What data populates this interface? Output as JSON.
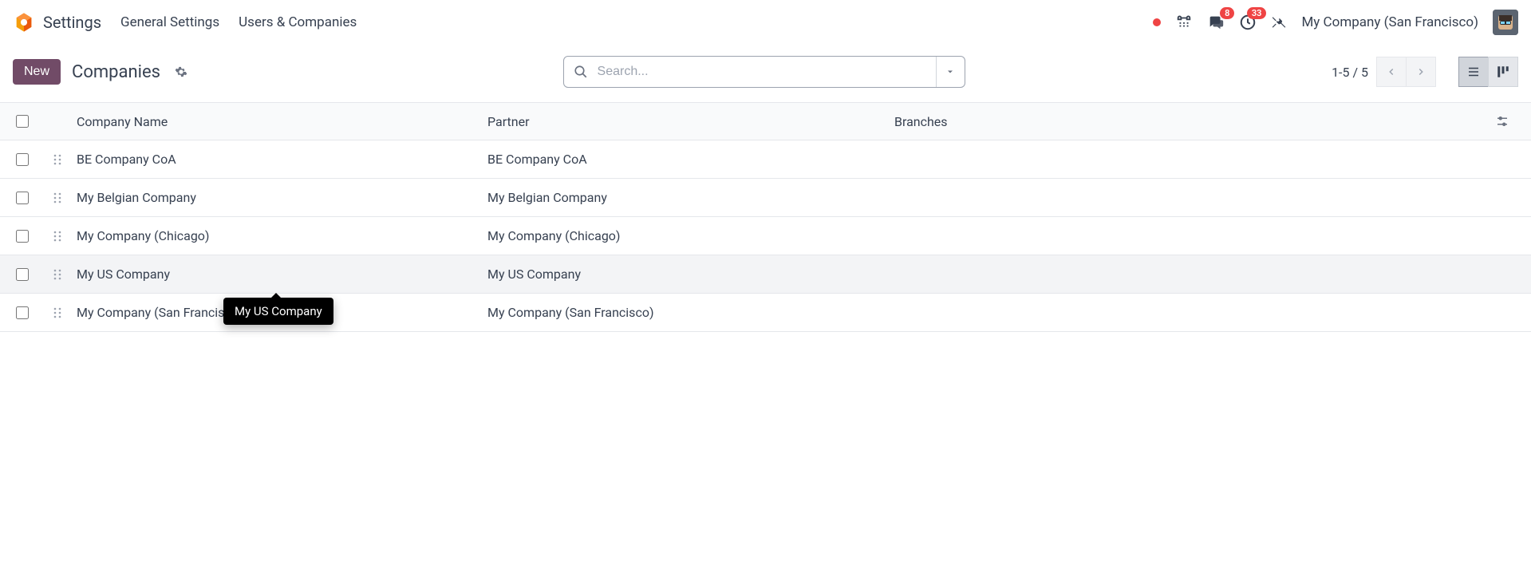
{
  "app": {
    "title": "Settings"
  },
  "nav": {
    "general": "General Settings",
    "users": "Users & Companies"
  },
  "topright": {
    "messages_badge": "8",
    "activities_badge": "33",
    "company": "My Company (San Francisco)"
  },
  "controls": {
    "new_label": "New",
    "breadcrumb": "Companies",
    "search_placeholder": "Search...",
    "pager": "1-5 / 5"
  },
  "table": {
    "headers": {
      "name": "Company Name",
      "partner": "Partner",
      "branches": "Branches"
    },
    "rows": [
      {
        "name": "BE Company CoA",
        "partner": "BE Company CoA",
        "branches": ""
      },
      {
        "name": "My Belgian Company",
        "partner": "My Belgian Company",
        "branches": ""
      },
      {
        "name": "My Company (Chicago)",
        "partner": "My Company (Chicago)",
        "branches": ""
      },
      {
        "name": "My US Company",
        "partner": "My US Company",
        "branches": ""
      },
      {
        "name": "My Company (San Francisco)",
        "partner": "My Company (San Francisco)",
        "branches": ""
      }
    ]
  },
  "tooltip": {
    "text": "My US Company"
  }
}
